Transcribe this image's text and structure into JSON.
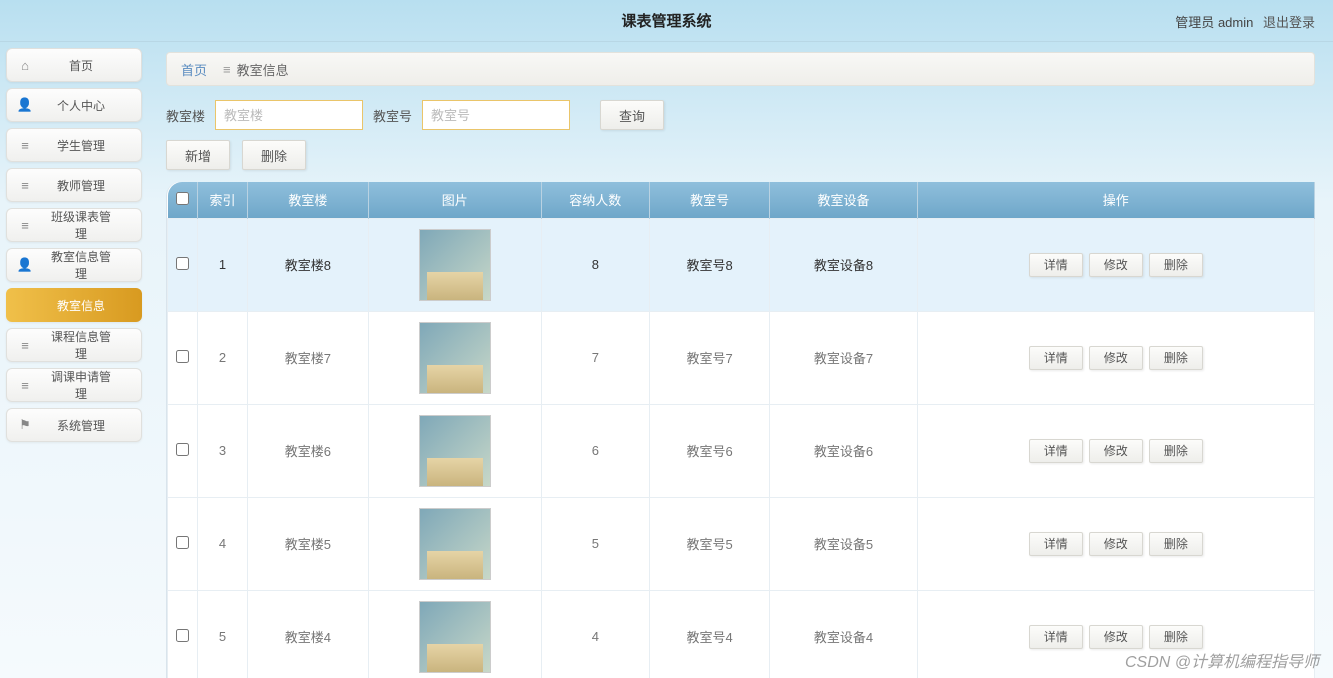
{
  "header": {
    "title": "课表管理系统",
    "user_prefix": "管理员",
    "user_name": "admin",
    "logout": "退出登录"
  },
  "sidebar": {
    "items": [
      {
        "icon": "home",
        "label": "首页"
      },
      {
        "icon": "user",
        "label": "个人中心"
      },
      {
        "icon": "list",
        "label": "学生管理"
      },
      {
        "icon": "list",
        "label": "教师管理"
      },
      {
        "icon": "list",
        "label": "班级课表管理"
      },
      {
        "icon": "user",
        "label": "教室信息管理"
      },
      {
        "icon": "none",
        "label": "教室信息",
        "active": true
      },
      {
        "icon": "list",
        "label": "课程信息管理"
      },
      {
        "icon": "list",
        "label": "调课申请管理"
      },
      {
        "icon": "flag",
        "label": "系统管理"
      }
    ]
  },
  "breadcrumb": {
    "home": "首页",
    "current": "教室信息"
  },
  "search": {
    "building_label": "教室楼",
    "building_placeholder": "教室楼",
    "room_label": "教室号",
    "room_placeholder": "教室号",
    "query_btn": "查询"
  },
  "top_actions": {
    "add": "新增",
    "delete": "删除"
  },
  "table": {
    "columns": [
      "",
      "索引",
      "教室楼",
      "图片",
      "容纳人数",
      "教室号",
      "教室设备",
      "操作"
    ],
    "rows": [
      {
        "idx": "1",
        "building": "教室楼8",
        "capacity": "8",
        "room": "教室号8",
        "equip": "教室设备8",
        "sel": true
      },
      {
        "idx": "2",
        "building": "教室楼7",
        "capacity": "7",
        "room": "教室号7",
        "equip": "教室设备7"
      },
      {
        "idx": "3",
        "building": "教室楼6",
        "capacity": "6",
        "room": "教室号6",
        "equip": "教室设备6"
      },
      {
        "idx": "4",
        "building": "教室楼5",
        "capacity": "5",
        "room": "教室号5",
        "equip": "教室设备5"
      },
      {
        "idx": "5",
        "building": "教室楼4",
        "capacity": "4",
        "room": "教室号4",
        "equip": "教室设备4"
      }
    ],
    "row_actions": {
      "detail": "详情",
      "edit": "修改",
      "delete": "删除"
    }
  },
  "watermark": "CSDN @计算机编程指导师"
}
